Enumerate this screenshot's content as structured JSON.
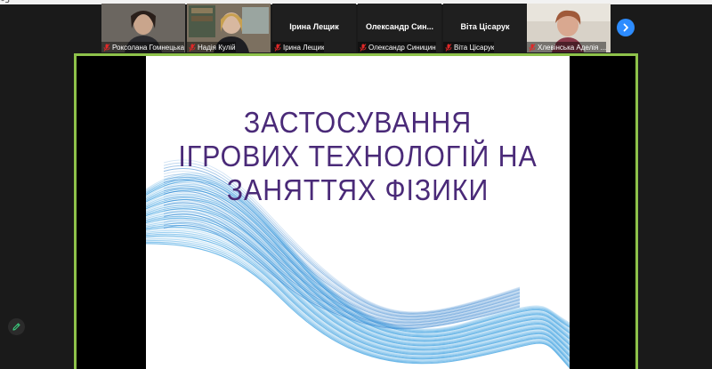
{
  "topbar": {
    "glyph": "∂ʒⁿ"
  },
  "participants": [
    {
      "caption": "Роксолана Гомнецька",
      "has_video": true,
      "muted": true
    },
    {
      "caption": "Надія Кулій",
      "has_video": true,
      "muted": true
    },
    {
      "display_name": "Ірина Лещик",
      "caption": "Ірина Лещик",
      "has_video": false,
      "muted": true
    },
    {
      "display_name": "Олександр Син...",
      "caption": "Олександр Синицин",
      "has_video": false,
      "muted": true
    },
    {
      "display_name": "Віта Цісарук",
      "caption": "Віта Цісарук",
      "has_video": false,
      "muted": true
    },
    {
      "caption": "Хлевінська Аделія ...",
      "has_video": true,
      "muted": true
    }
  ],
  "icons": {
    "next": "chevron-right-icon",
    "annotate": "pencil-icon",
    "mic": "mic-muted-icon"
  },
  "slide": {
    "title_lines": [
      "ЗАСТОСУВАННЯ",
      "ІГРОВИХ ТЕХНОЛОГІЙ НА",
      "ЗАНЯТТЯХ  ФІЗИКИ"
    ]
  },
  "colors": {
    "share_border": "#8ec24a",
    "next_button": "#2d8cff",
    "title_text": "#4a2a78",
    "mic_muted": "#e02828",
    "wave": "#3a9fe0"
  }
}
